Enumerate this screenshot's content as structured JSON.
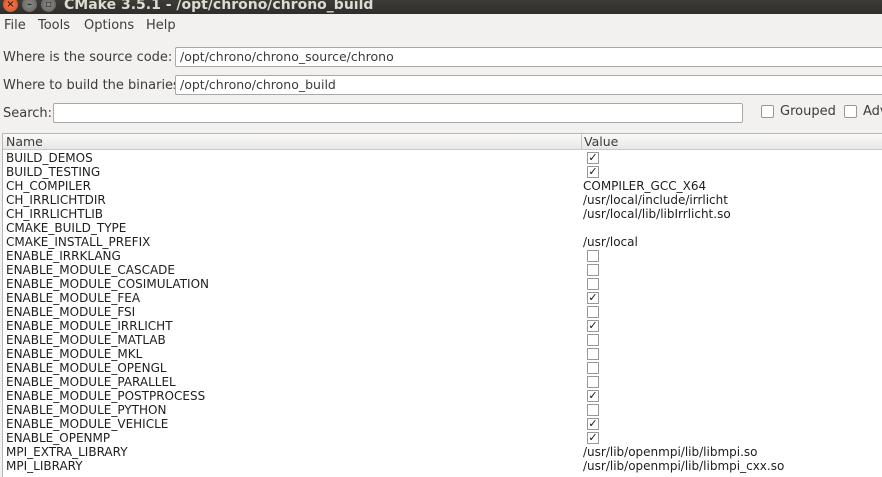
{
  "window": {
    "title": "CMake 3.5.1 - /opt/chrono/chrono_build"
  },
  "menu": [
    "File",
    "Tools",
    "Options",
    "Help"
  ],
  "source": {
    "label": "Where is the source code:",
    "value": "/opt/chrono/chrono_source/chrono"
  },
  "build": {
    "label": "Where to build the binaries:",
    "value": "/opt/chrono/chrono_build"
  },
  "search": {
    "label": "Search:",
    "value": ""
  },
  "options": {
    "grouped": "Grouped",
    "advanced": "Adv"
  },
  "table": {
    "headers": [
      "Name",
      "Value"
    ],
    "rows": [
      {
        "name": "BUILD_DEMOS",
        "type": "bool",
        "checked": true
      },
      {
        "name": "BUILD_TESTING",
        "type": "bool",
        "checked": true
      },
      {
        "name": "CH_COMPILER",
        "type": "text",
        "value": "COMPILER_GCC_X64"
      },
      {
        "name": "CH_IRRLICHTDIR",
        "type": "text",
        "value": "/usr/local/include/irrlicht"
      },
      {
        "name": "CH_IRRLICHTLIB",
        "type": "text",
        "value": "/usr/local/lib/libIrrlicht.so"
      },
      {
        "name": "CMAKE_BUILD_TYPE",
        "type": "text",
        "value": ""
      },
      {
        "name": "CMAKE_INSTALL_PREFIX",
        "type": "text",
        "value": "/usr/local"
      },
      {
        "name": "ENABLE_IRRKLANG",
        "type": "bool",
        "checked": false
      },
      {
        "name": "ENABLE_MODULE_CASCADE",
        "type": "bool",
        "checked": false
      },
      {
        "name": "ENABLE_MODULE_COSIMULATION",
        "type": "bool",
        "checked": false
      },
      {
        "name": "ENABLE_MODULE_FEA",
        "type": "bool",
        "checked": true
      },
      {
        "name": "ENABLE_MODULE_FSI",
        "type": "bool",
        "checked": false
      },
      {
        "name": "ENABLE_MODULE_IRRLICHT",
        "type": "bool",
        "checked": true
      },
      {
        "name": "ENABLE_MODULE_MATLAB",
        "type": "bool",
        "checked": false
      },
      {
        "name": "ENABLE_MODULE_MKL",
        "type": "bool",
        "checked": false
      },
      {
        "name": "ENABLE_MODULE_OPENGL",
        "type": "bool",
        "checked": false
      },
      {
        "name": "ENABLE_MODULE_PARALLEL",
        "type": "bool",
        "checked": false
      },
      {
        "name": "ENABLE_MODULE_POSTPROCESS",
        "type": "bool",
        "checked": true
      },
      {
        "name": "ENABLE_MODULE_PYTHON",
        "type": "bool",
        "checked": false
      },
      {
        "name": "ENABLE_MODULE_VEHICLE",
        "type": "bool",
        "checked": true
      },
      {
        "name": "ENABLE_OPENMP",
        "type": "bool",
        "checked": true
      },
      {
        "name": "MPI_EXTRA_LIBRARY",
        "type": "text",
        "value": "/usr/lib/openmpi/lib/libmpi.so"
      },
      {
        "name": "MPI_LIBRARY",
        "type": "text",
        "value": "/usr/lib/openmpi/lib/libmpi_cxx.so"
      }
    ]
  }
}
